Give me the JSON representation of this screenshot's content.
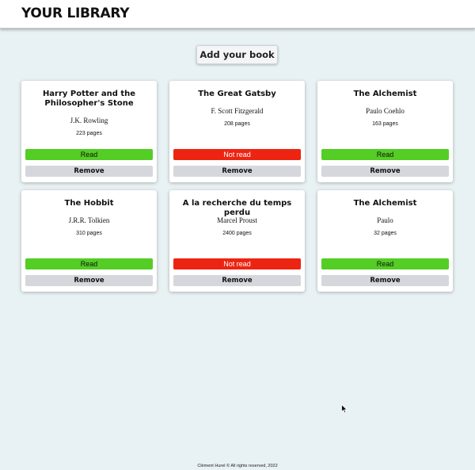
{
  "header": {
    "title": "YOUR LIBRARY"
  },
  "actions": {
    "add_label": "Add your book"
  },
  "books": [
    {
      "title": "Harry Potter and the Philosopher's Stone",
      "author": "J.K. Rowling",
      "pages": "223 pages",
      "status": "Read",
      "read": true,
      "remove_label": "Remove"
    },
    {
      "title": "The Great Gatsby",
      "author": "F. Scott Fitzgerald",
      "pages": "208 pages",
      "status": "Not read",
      "read": false,
      "remove_label": "Remove"
    },
    {
      "title": "The Alchemist",
      "author": "Paulo Coehlo",
      "pages": "163 pages",
      "status": "Read",
      "read": true,
      "remove_label": "Remove"
    },
    {
      "title": "The Hobbit",
      "author": "J.R.R. Tolkien",
      "pages": "310 pages",
      "status": "Read",
      "read": true,
      "remove_label": "Remove"
    },
    {
      "title": "A la recherche du temps perdu",
      "author": "Marcel Proust",
      "pages": "2400 pages",
      "status": "Not read",
      "read": false,
      "remove_label": "Remove"
    },
    {
      "title": "The Alchemist",
      "author": "Paulo",
      "pages": "32 pages",
      "status": "Read",
      "read": true,
      "remove_label": "Remove"
    }
  ],
  "colors": {
    "read": "#54cd25",
    "not_read": "#ee2412",
    "remove": "#d6d7dc",
    "background": "#e8f1f3"
  },
  "footer": {
    "text": "Clément Hurel © All rights reserved, 2022"
  }
}
